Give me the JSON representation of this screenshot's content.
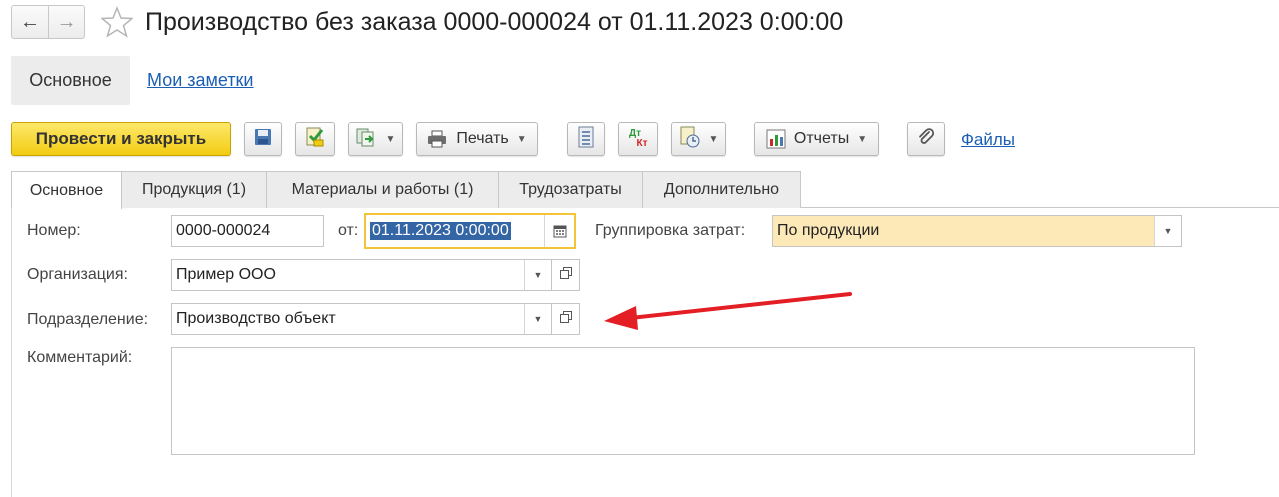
{
  "window": {
    "title": "Производство без заказа 0000-000024 от 01.11.2023 0:00:00",
    "nav_back_icon": "←",
    "nav_forward_icon": "→"
  },
  "sections": {
    "active": "Основное",
    "notes_link": "Мои заметки"
  },
  "toolbar": {
    "post_close": "Провести и закрыть",
    "print": "Печать",
    "reports": "Отчеты",
    "files": "Файлы",
    "dt_top": "Дт",
    "kt_bottom": "Кт",
    "accent": "#f2cc12"
  },
  "tabs": [
    {
      "label": "Основное",
      "active": true
    },
    {
      "label": "Продукция (1)"
    },
    {
      "label": "Материалы и работы (1)"
    },
    {
      "label": "Трудозатраты"
    },
    {
      "label": "Дополнительно"
    }
  ],
  "form": {
    "number_label": "Номер:",
    "number_value": "0000-000024",
    "date_label": "от:",
    "date_value": "01.11.2023  0:00:00",
    "cost_grouping_label": "Группировка затрат:",
    "cost_grouping_value": "По продукции",
    "organization_label": "Организация:",
    "organization_value": "Пример ООО",
    "division_label": "Подразделение:",
    "division_value": "Производство объект",
    "comment_label": "Комментарий:",
    "comment_value": ""
  },
  "annotation": {
    "arrow_color": "#e31e24"
  }
}
